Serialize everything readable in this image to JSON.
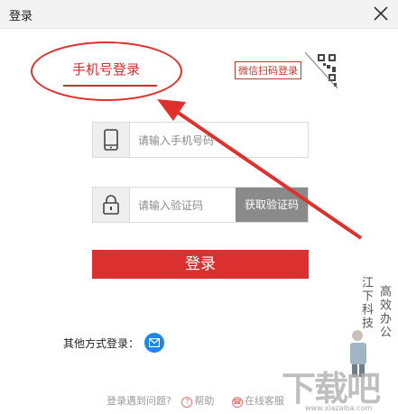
{
  "window": {
    "title": "登录"
  },
  "login": {
    "tab_phone": "手机号登录",
    "wechat_label": "微信扫码登录",
    "phone_placeholder": "请输入手机号码",
    "code_placeholder": "请输入验证码",
    "get_code_label": "获取验证码",
    "submit_label": "登录"
  },
  "other": {
    "label": "其他方式登录："
  },
  "footer": {
    "problem": "登录遇到问题?",
    "help": "帮助",
    "service": "在线客服"
  },
  "watermark": {
    "line1": "江下科技",
    "line2": "高效办公",
    "site": "下载吧",
    "site_small": "www.xiazaiba.com"
  },
  "colors": {
    "accent": "#dc2f2f",
    "annotation": "#e0302b",
    "mail": "#1e88e5"
  }
}
